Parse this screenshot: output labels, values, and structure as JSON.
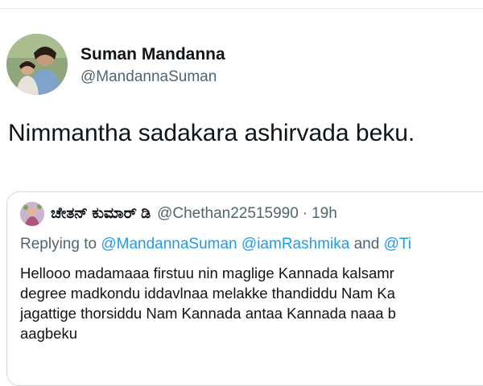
{
  "tweet": {
    "author": {
      "display_name": "Suman Mandanna",
      "handle": "@MandannaSuman",
      "avatar_icon": "profile-photo"
    },
    "text": "Nimmantha sadakara ashirvada beku."
  },
  "quoted_tweet": {
    "author_name": "ಚೇತನ್ ಕುಮಾರ್ ಡಿ",
    "author_handle": "@Chethan22515990",
    "separator": "·",
    "time": "19h",
    "replying_prefix": "Replying to",
    "replying_mentions": [
      "@MandannaSuman",
      "@iamRashmika",
      "and",
      "@Ti"
    ],
    "body_lines": [
      "Hellooo madamaaa firstuu nin maglige Kannada kalsamr",
      "degree madkondu iddavlnaa melakke thandiddu Nam Ka",
      "jagattige thorsiddu Nam Kannada antaa Kannada naaa b",
      "aagbeku"
    ]
  },
  "colors": {
    "text_primary": "#0f1419",
    "text_secondary": "#536471",
    "link": "#1d9bf0",
    "border": "#cfd9de"
  }
}
